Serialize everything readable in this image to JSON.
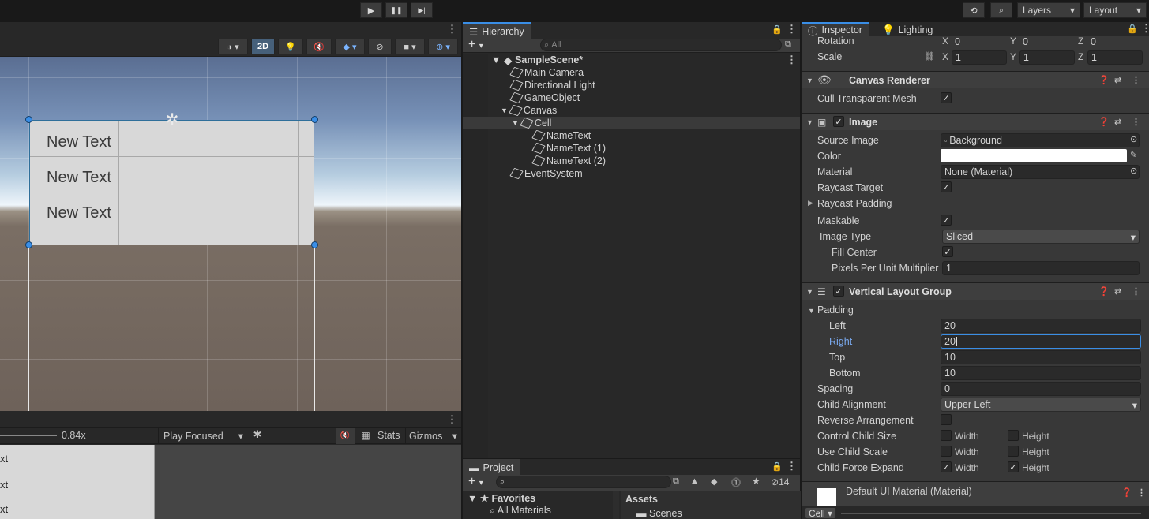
{
  "toolbar": {
    "play": "▶",
    "pause": "❚❚",
    "step": "▶|",
    "history": "⟲",
    "search": "🔍",
    "layers": "Layers",
    "layout": "Layout"
  },
  "scene": {
    "btn_2d": "2D",
    "texts": [
      "New Text",
      "New Text",
      "New Text"
    ]
  },
  "game": {
    "zoom": "0.84x",
    "play_mode": "Play Focused",
    "stats": "Stats",
    "gizmos": "Gizmos",
    "rows": [
      "xt",
      "xt",
      "xt"
    ]
  },
  "hierarchy": {
    "tab": "Hierarchy",
    "search_placeholder": "All",
    "items": [
      {
        "label": "SampleScene*"
      },
      {
        "label": "Main Camera"
      },
      {
        "label": "Directional Light"
      },
      {
        "label": "GameObject"
      },
      {
        "label": "Canvas"
      },
      {
        "label": "Cell"
      },
      {
        "label": "NameText"
      },
      {
        "label": "NameText (1)"
      },
      {
        "label": "NameText (2)"
      },
      {
        "label": "EventSystem"
      }
    ]
  },
  "project": {
    "tab": "Project",
    "count": "14",
    "favorites": "Favorites",
    "all_materials": "All Materials",
    "assets": "Assets",
    "scenes": "Scenes"
  },
  "inspector": {
    "tab": "Inspector",
    "tab2": "Lighting",
    "rotation": {
      "label": "Rotation",
      "x": "0",
      "y": "0",
      "z": "0"
    },
    "scale": {
      "label": "Scale",
      "x": "1",
      "y": "1",
      "z": "1"
    },
    "axis": {
      "x": "X",
      "y": "Y",
      "z": "Z"
    },
    "canvas_renderer": {
      "title": "Canvas Renderer",
      "cull_label": "Cull Transparent Mesh"
    },
    "image": {
      "title": "Image",
      "source_label": "Source Image",
      "source_value": "Background",
      "color_label": "Color",
      "material_label": "Material",
      "material_value": "None (Material)",
      "raycast_label": "Raycast Target",
      "raycast_padding": "Raycast Padding",
      "maskable": "Maskable",
      "image_type_label": "Image Type",
      "image_type_value": "Sliced",
      "fill_center": "Fill Center",
      "ppu_label": "Pixels Per Unit Multiplier",
      "ppu_value": "1"
    },
    "vlg": {
      "title": "Vertical Layout Group",
      "padding": "Padding",
      "left_label": "Left",
      "left": "20",
      "right_label": "Right",
      "right": "20",
      "top_label": "Top",
      "top": "10",
      "bottom_label": "Bottom",
      "bottom": "10",
      "spacing_label": "Spacing",
      "spacing": "0",
      "child_align_label": "Child Alignment",
      "child_align": "Upper Left",
      "reverse": "Reverse Arrangement",
      "control_size": "Control Child Size",
      "use_scale": "Use Child Scale",
      "force_expand": "Child Force Expand",
      "width": "Width",
      "height": "Height"
    },
    "material": {
      "name": "Default UI Material (Material)"
    },
    "cell_dropdown": "Cell"
  },
  "colors": {
    "accent": "#3a8ee6",
    "selected_row": "#3a3a3a",
    "scene_text": "#3a3a3a"
  }
}
